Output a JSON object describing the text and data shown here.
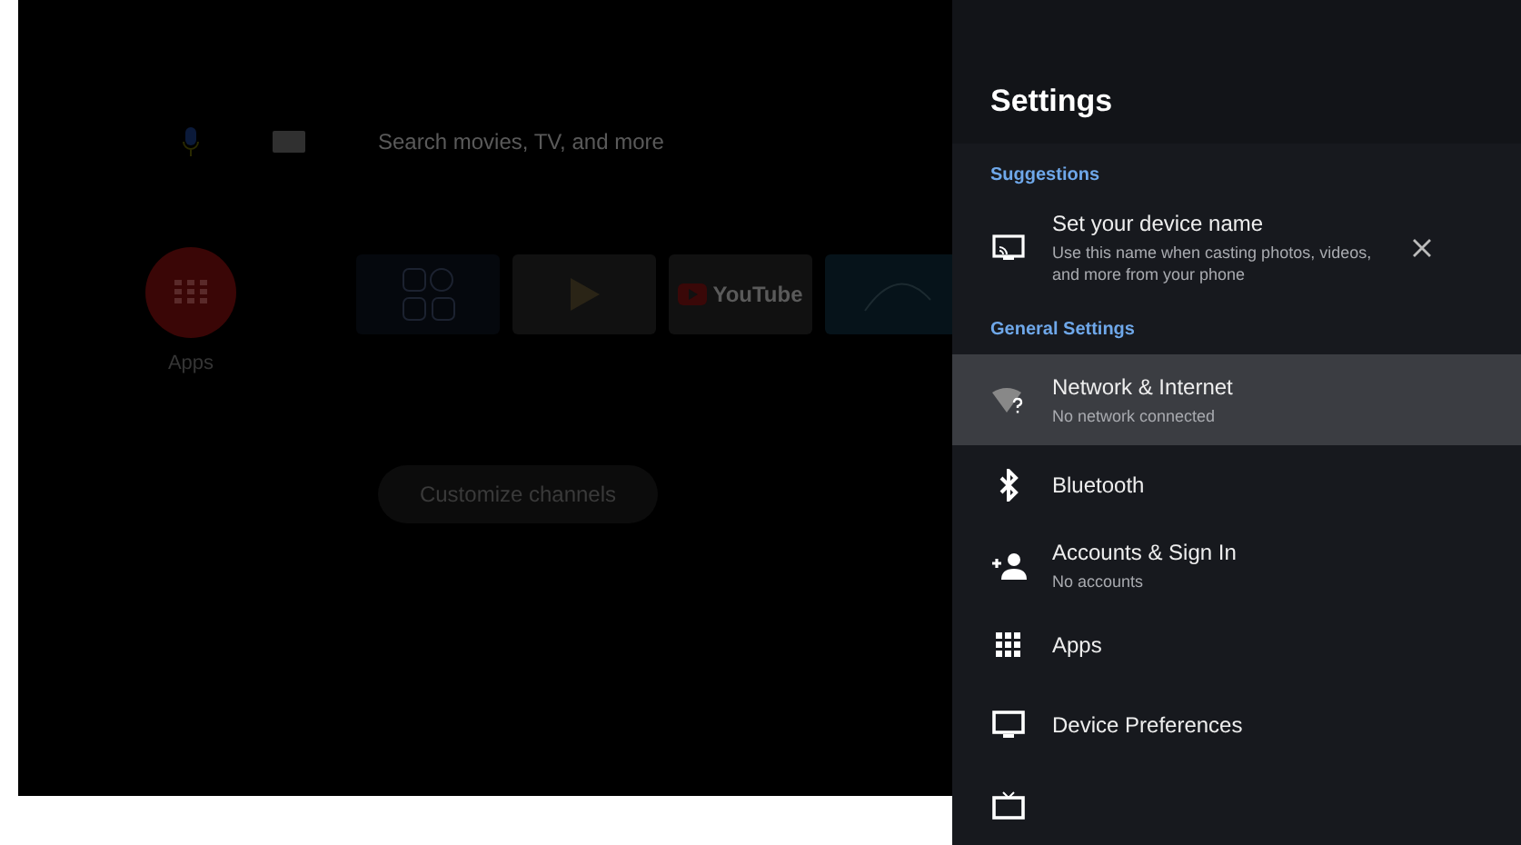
{
  "home": {
    "search": {
      "placeholder": "Search movies, TV, and more"
    },
    "apps_label": "Apps",
    "tiles": [
      {
        "kind": "grid"
      },
      {
        "kind": "play"
      },
      {
        "kind": "youtube",
        "label": "YouTube"
      },
      {
        "kind": "disney"
      }
    ],
    "customize_button": "Customize channels"
  },
  "settings": {
    "title": "Settings",
    "sections": [
      {
        "heading": "Suggestions",
        "items": [
          {
            "kind": "cast",
            "title": "Set your device name",
            "subtitle": "Use this name when casting photos, videos, and more from your phone",
            "dismissible": true,
            "selected": false
          }
        ]
      },
      {
        "heading": "General Settings",
        "items": [
          {
            "kind": "wifi",
            "title": "Network & Internet",
            "subtitle": "No network connected",
            "selected": true
          },
          {
            "kind": "bluetooth",
            "title": "Bluetooth",
            "selected": false
          },
          {
            "kind": "account",
            "title": "Accounts & Sign In",
            "subtitle": "No accounts",
            "selected": false
          },
          {
            "kind": "apps",
            "title": "Apps",
            "selected": false
          },
          {
            "kind": "display",
            "title": "Device Preferences",
            "selected": false
          },
          {
            "kind": "tv",
            "selected": false
          }
        ]
      }
    ]
  }
}
